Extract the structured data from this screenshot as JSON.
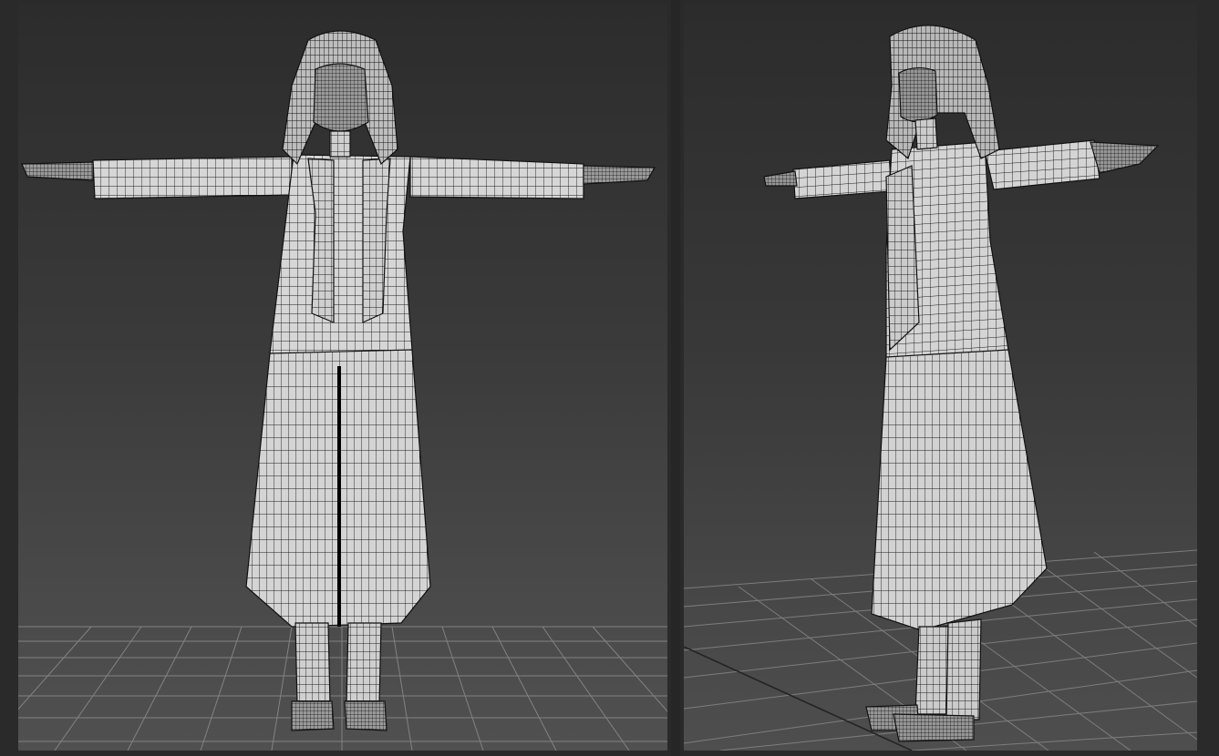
{
  "viewports": [
    {
      "id": "front",
      "view": "front",
      "display_mode": "wireframe-over-shaded",
      "grid_visible": true,
      "model": "character-t-pose"
    },
    {
      "id": "perspective",
      "view": "perspective",
      "display_mode": "wireframe-over-shaded",
      "grid_visible": true,
      "model": "character-t-pose"
    }
  ],
  "colors": {
    "background": "#2a2a2a",
    "viewport_top": "#2c2c2c",
    "viewport_bottom": "#505050",
    "grid_line": "#8a8a8a",
    "mesh_fill": "#d9d9d9",
    "wire": "#1a1a1a"
  }
}
